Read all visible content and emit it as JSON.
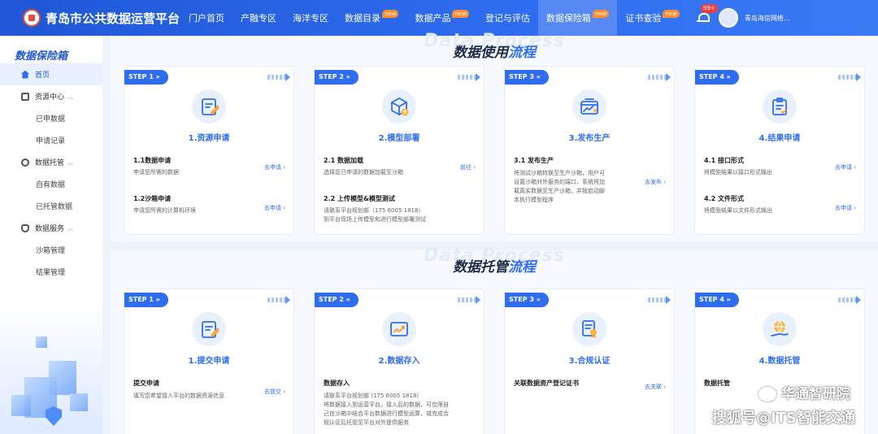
{
  "header": {
    "title": "青岛市公共数据运营平台",
    "nav": [
      {
        "label": "门户首页",
        "new": false
      },
      {
        "label": "产融专区",
        "new": false
      },
      {
        "label": "海洋专区",
        "new": false
      },
      {
        "label": "数据目录",
        "new": true
      },
      {
        "label": "数据产品",
        "new": true
      },
      {
        "label": "登记与评估",
        "new": false
      },
      {
        "label": "数据保险箱",
        "new": true,
        "active": true
      },
      {
        "label": "证书查验",
        "new": true
      }
    ],
    "new_badge": "new",
    "notify_count": "99+",
    "user_name": "青岛海信网络..."
  },
  "sidebar": {
    "title": "数据保险箱",
    "items": [
      {
        "label": "首页",
        "icon": "home-icon",
        "active": true
      },
      {
        "label": "资源中心",
        "icon": "resource-icon",
        "expandable": true
      },
      {
        "label": "已申数据",
        "sub": true
      },
      {
        "label": "申请记录",
        "sub": true
      },
      {
        "label": "数据托管",
        "icon": "pie-chart-icon",
        "expandable": true
      },
      {
        "label": "自有数据",
        "sub": true
      },
      {
        "label": "已托管数据",
        "sub": true
      },
      {
        "label": "数据服务",
        "icon": "service-icon",
        "expandable": true
      },
      {
        "label": "沙箱管理",
        "sub": true
      },
      {
        "label": "结果管理",
        "sub": true
      }
    ]
  },
  "usage": {
    "watermark": "Data Process",
    "title_main": "数据使用",
    "title_accent": "流程",
    "cards": [
      {
        "step": "STEP 1 »",
        "title": "1.资源申请",
        "icon": "edit-doc-icon",
        "items": [
          {
            "title": "1.1数据申请",
            "desc": "申请您所需的数据",
            "link": "去申请 ›"
          },
          {
            "title": "1.2沙箱申请",
            "desc": "申请您所需的计算机环境",
            "link": "去申请 ›"
          }
        ]
      },
      {
        "step": "STEP 2 »",
        "title": "2.模型部署",
        "icon": "cube-upload-icon",
        "items": [
          {
            "title": "2.1 数据加载",
            "desc": "选择您已申请的数据加载至沙箱",
            "link": "前往 ›"
          },
          {
            "title": "2.2 上传模型&模型测试",
            "desc": "请联系平台规划部（175 6005 1818）\n到平台现场上传模型和进行模型部署测试",
            "link": ""
          }
        ]
      },
      {
        "step": "STEP 3 »",
        "title": "3.发布生产",
        "icon": "publish-chart-icon",
        "items": [
          {
            "title": "3.1 发布生产",
            "desc": "将测试沙箱转换至生产沙箱，用户可\n设置沙箱对外服务的端口，系统将加\n载真实数据至生产沙箱，并按启动脚\n本执行模型程序",
            "link": "去发布 ›"
          }
        ]
      },
      {
        "step": "STEP 4 »",
        "title": "4.结果申请",
        "icon": "checklist-icon",
        "items": [
          {
            "title": "4.1 接口形式",
            "desc": "将模型结果以接口形式输出",
            "link": "去申请 ›"
          },
          {
            "title": "4.2 文件形式",
            "desc": "将模型结果以文件形式输出",
            "link": "去申请 ›"
          }
        ]
      }
    ]
  },
  "hosting": {
    "watermark": "Data Process",
    "title_main": "数据托管",
    "title_accent": "流程",
    "cards": [
      {
        "step": "STEP 1 »",
        "title": "1.提交申请",
        "icon": "edit-doc-icon",
        "items": [
          {
            "title": "提交申请",
            "desc": "填写您希望接入平台的数据资源信息",
            "link": "去提交 ›"
          }
        ]
      },
      {
        "step": "STEP 2 »",
        "title": "2.数据存入",
        "icon": "trend-chart-icon",
        "items": [
          {
            "title": "数据存入",
            "desc": "请联系平台规划部 (175 6005 1818)\n将数据接入到运营平台。接入后的数据，可仅限自\n己在沙箱中结合平台数据进行模型运算，或完成合\n规认证后托管至平台对外提供服务",
            "link": ""
          }
        ]
      },
      {
        "step": "STEP 3 »",
        "title": "3.合规认证",
        "icon": "certificate-icon",
        "items": [
          {
            "title": "关联数据资产登记证书",
            "desc": "",
            "link": "去关联 ›"
          }
        ]
      },
      {
        "step": "STEP 4 »",
        "title": "4.数据托管",
        "icon": "globe-hand-icon",
        "items": [
          {
            "title": "数据托管",
            "desc": "",
            "link": ""
          }
        ]
      }
    ]
  },
  "watermark": {
    "line1": "华通智研院",
    "line2": "搜狐号@ITS智能交通"
  }
}
